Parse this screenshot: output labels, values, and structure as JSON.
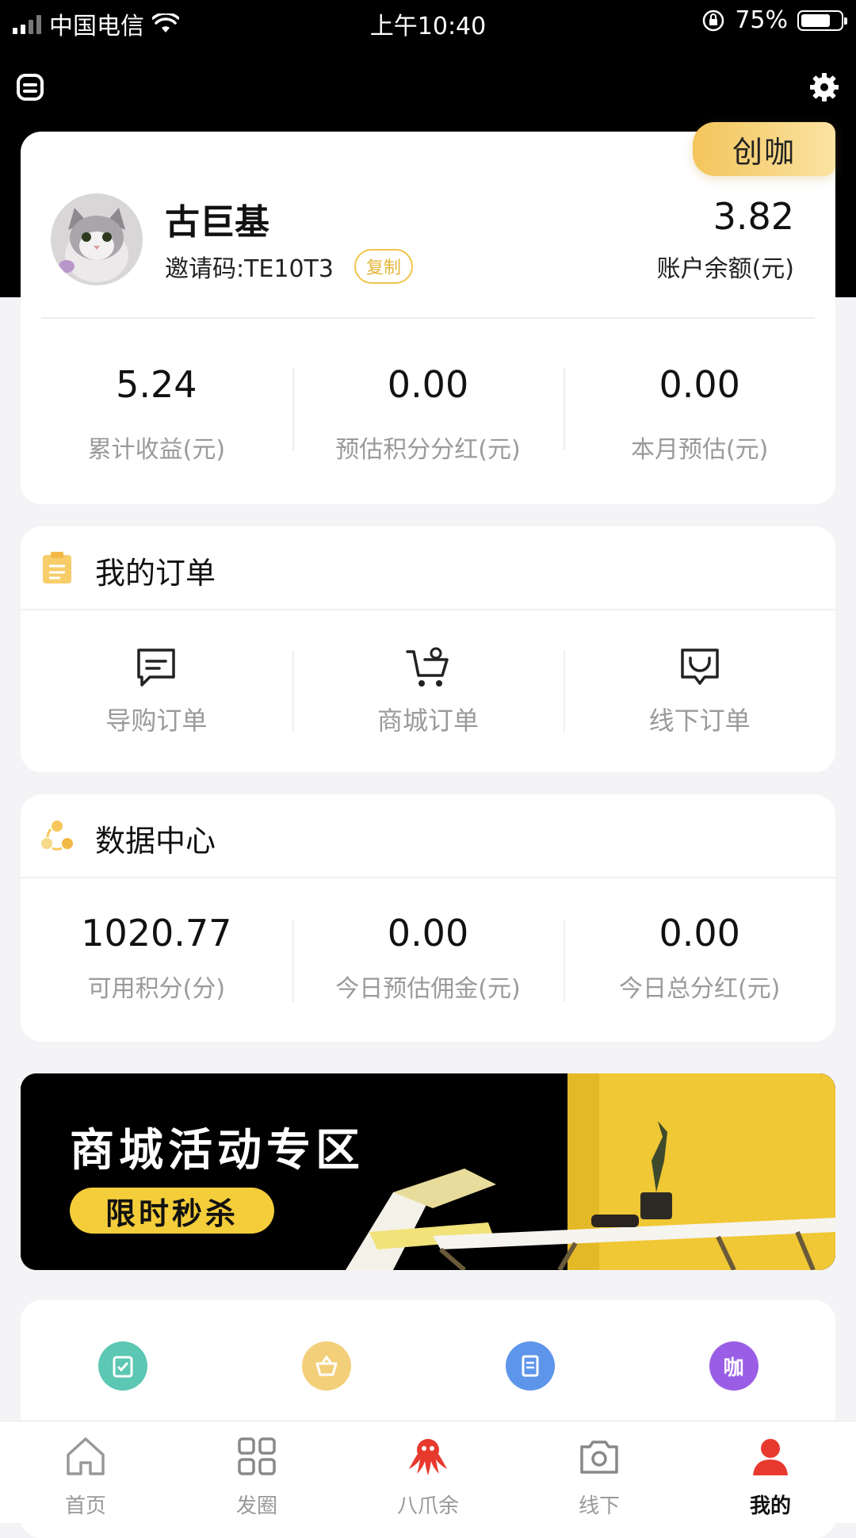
{
  "status_bar": {
    "carrier": "中国电信",
    "time": "上午10:40",
    "battery": "75%",
    "battery_level": 0.75
  },
  "profile": {
    "badge": "创咖",
    "name": "古巨基",
    "invite_code": "邀请码:TE10T3",
    "copy_label": "复制",
    "balance": "3.82",
    "balance_label": "账户余额(元)",
    "stats": [
      {
        "value": "5.24",
        "label": "累计收益(元)"
      },
      {
        "value": "0.00",
        "label": "预估积分分红(元)"
      },
      {
        "value": "0.00",
        "label": "本月预估(元)"
      }
    ]
  },
  "orders": {
    "title": "我的订单",
    "items": [
      {
        "label": "导购订单",
        "icon": "chat-bubble-icon"
      },
      {
        "label": "商城订单",
        "icon": "cart-icon"
      },
      {
        "label": "线下订单",
        "icon": "shop-icon"
      }
    ]
  },
  "data_center": {
    "title": "数据中心",
    "stats": [
      {
        "value": "1020.77",
        "label": "可用积分(分)"
      },
      {
        "value": "0.00",
        "label": "今日预估佣金(元)"
      },
      {
        "value": "0.00",
        "label": "今日总分红(元)"
      }
    ]
  },
  "banner": {
    "title": "商城活动专区",
    "button": "限时秒杀"
  },
  "features": [
    {
      "icon": "clipboard-check-icon",
      "color": "#5cc7b2",
      "text": ""
    },
    {
      "icon": "basket-icon",
      "color": "#f3cf7a",
      "text": ""
    },
    {
      "icon": "document-icon",
      "color": "#5d95ea",
      "text": ""
    },
    {
      "icon": "ka-icon",
      "color": "#9a5ee6",
      "text": "咖"
    }
  ],
  "tabbar": [
    {
      "label": "首页",
      "icon": "home-icon"
    },
    {
      "label": "发圈",
      "icon": "grid-icon"
    },
    {
      "label": "八爪余",
      "icon": "octopus-icon"
    },
    {
      "label": "线下",
      "icon": "camera-icon"
    },
    {
      "label": "我的",
      "icon": "person-icon"
    }
  ],
  "colors": {
    "accent": "#f4cd3a",
    "brand_red": "#e8392f",
    "black": "#000000"
  }
}
